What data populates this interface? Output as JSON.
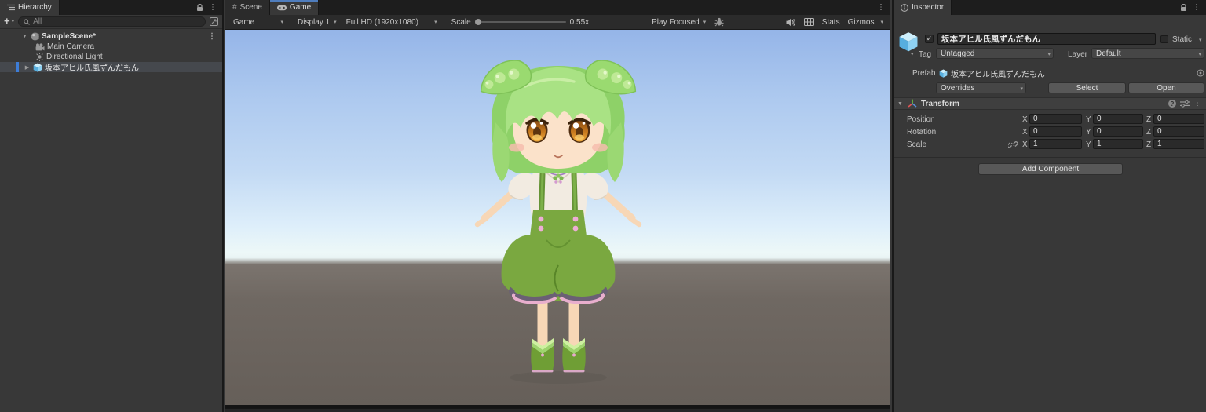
{
  "colors": {
    "accent_blue": "#4f7dbd",
    "selection_bg": "#45484d",
    "selection_bar": "#3d7dd8",
    "panel_bg": "#383838",
    "tabbar_bg": "#1d1d1d",
    "sky_top": "#95b5e8",
    "sky_horizon": "#edf8f8",
    "ground": "#6e6660",
    "character_hair": "#a9e284",
    "character_outfit": "#7aa840"
  },
  "icons": {
    "kebab": "⋮",
    "dropdown": "▾",
    "foldout_open": "▼",
    "foldout_closed": "▶",
    "plus": "+",
    "hash": "#",
    "check": "✓",
    "help": "?"
  },
  "hierarchy": {
    "tab": "Hierarchy",
    "search_placeholder": "All",
    "scene": {
      "label": "SampleScene*"
    },
    "items": [
      {
        "label": "Main Camera"
      },
      {
        "label": "Directional Light"
      },
      {
        "label": "坂本アヒル氏風ずんだもん"
      }
    ]
  },
  "game": {
    "tabs": {
      "scene": "Scene",
      "game": "Game"
    },
    "toolbar": {
      "display_mode": "Game",
      "display": "Display 1",
      "resolution": "Full HD (1920x1080)",
      "scale_label": "Scale",
      "scale_value": "0.55x",
      "play_mode": "Play Focused",
      "stats_label": "Stats",
      "gizmos_label": "Gizmos"
    }
  },
  "inspector": {
    "tab": "Inspector",
    "header": {
      "name": "坂本アヒル氏風ずんだもん",
      "static_label": "Static",
      "tag_label": "Tag",
      "tag_value": "Untagged",
      "layer_label": "Layer",
      "layer_value": "Default"
    },
    "prefab": {
      "label": "Prefab",
      "name": "坂本アヒル氏風ずんだもん",
      "overrides_label": "Overrides",
      "select_label": "Select",
      "open_label": "Open"
    },
    "transform": {
      "title": "Transform",
      "axis_labels": {
        "x": "X",
        "y": "Y",
        "z": "Z"
      },
      "rows": [
        {
          "label": "Position",
          "x": "0",
          "y": "0",
          "z": "0"
        },
        {
          "label": "Rotation",
          "x": "0",
          "y": "0",
          "z": "0"
        },
        {
          "label": "Scale",
          "x": "1",
          "y": "1",
          "z": "1"
        }
      ]
    },
    "add_component_label": "Add Component"
  }
}
